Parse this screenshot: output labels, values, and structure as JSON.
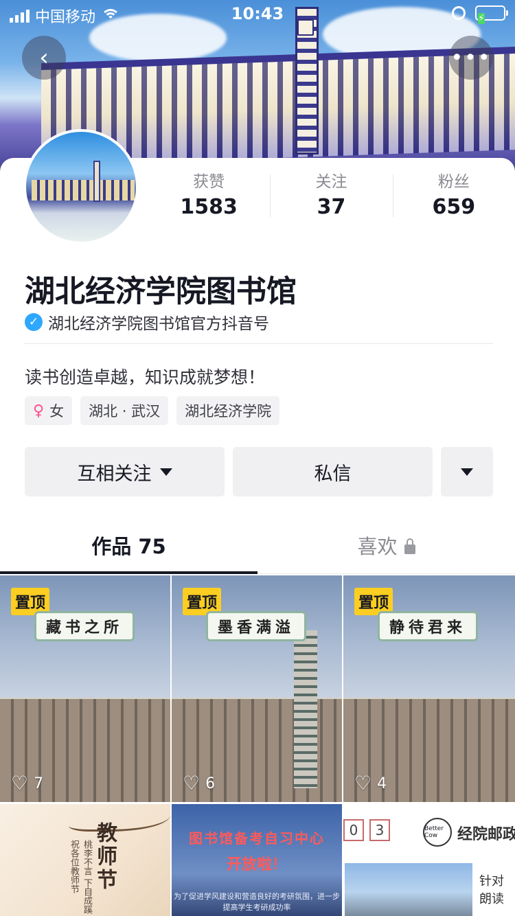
{
  "status_bar": {
    "carrier": "中国移动",
    "time": "10:43"
  },
  "header": {
    "back_icon": "chevron-left-icon",
    "more_icon": "more-dots-icon"
  },
  "profile": {
    "stats": [
      {
        "label": "获赞",
        "value": "1583"
      },
      {
        "label": "关注",
        "value": "37"
      },
      {
        "label": "粉丝",
        "value": "659"
      }
    ],
    "name": "湖北经济学院图书馆",
    "verified_text": "湖北经济学院图书馆官方抖音号",
    "bio": "读书创造卓越，知识成就梦想！",
    "tags": [
      "女",
      "湖北 · 武汉",
      "湖北经济学院"
    ]
  },
  "actions": {
    "follow_label": "互相关注",
    "message_label": "私信"
  },
  "tabs": [
    {
      "label": "作品 75"
    },
    {
      "label": "喜欢"
    }
  ],
  "videos": [
    {
      "pinned": "置顶",
      "caption": "藏书之所",
      "likes": "7"
    },
    {
      "pinned": "置顶",
      "caption": "墨香满溢",
      "likes": "6"
    },
    {
      "pinned": "置顶",
      "caption": "静待君来",
      "likes": "4"
    }
  ],
  "videos_row2": {
    "t4_title": "教师节",
    "t4_small": "桃李不言 下自成蹊 祝各位教师节",
    "t5_line1": "图书馆备考自习中心",
    "t5_line2": "开放啦！",
    "t5_line3": "为了促进学风建设和营造良好的考研氛围，进一步提高学生考研成功率",
    "t6_digits": [
      "0",
      "3"
    ],
    "t6_logo": "Better Cow",
    "t6_brand": "经院邮政",
    "t6_side": "针对 朗读"
  },
  "colors": {
    "accent_pin": "#fcce22",
    "verify_blue": "#2ea7ff",
    "text_primary": "#161823",
    "text_secondary": "#8a8b91"
  }
}
